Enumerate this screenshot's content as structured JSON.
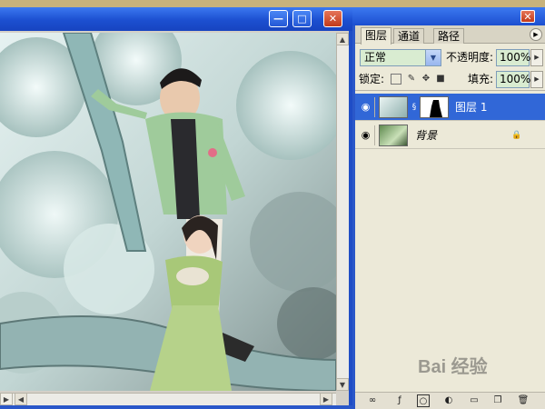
{
  "document_window": {
    "buttons": {
      "minimize": "—",
      "maximize": "□",
      "close": "✕"
    }
  },
  "layers_panel": {
    "close_glyph": "✕",
    "tabs": [
      {
        "label": "图层",
        "active": true
      },
      {
        "label": "通道",
        "active": false
      },
      {
        "label": "路径",
        "active": false
      }
    ],
    "blend_mode": "正常",
    "opacity_label": "不透明度:",
    "opacity_value": "100%",
    "lock_label": "锁定:",
    "fill_label": "填充:",
    "fill_value": "100%",
    "layers": [
      {
        "name": "图层 1",
        "selected": true,
        "visible": true,
        "has_mask": true
      },
      {
        "name": "背景",
        "selected": false,
        "visible": true,
        "locked": true
      }
    ]
  },
  "watermark": {
    "text": "Bai 经验"
  },
  "colors": {
    "title_blue": "#1c4fd0",
    "selected_row": "#3167d7",
    "panel_bg": "#ece9d8",
    "field_green": "#d9ecd1"
  },
  "icons": [
    "minimize-icon",
    "maximize-icon",
    "close-icon",
    "eye-icon",
    "chain-link-icon",
    "lock-icon",
    "brush-icon",
    "move-icon",
    "link-layers-icon",
    "layer-style-icon",
    "add-mask-icon",
    "adjustment-layer-icon",
    "new-group-icon",
    "new-layer-icon",
    "trash-icon"
  ]
}
